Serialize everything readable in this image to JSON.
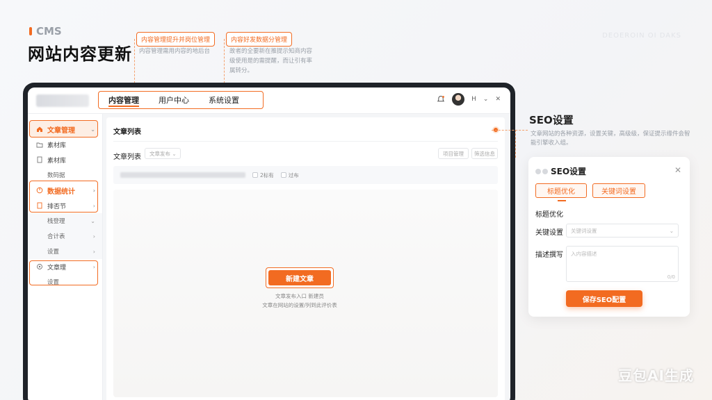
{
  "hero": {
    "brand": "CMS",
    "title": "网站内容更新",
    "watermark": "DEOEROIN OI DAKS"
  },
  "callouts": [
    {
      "tag": "内容管理提升并岗位管理",
      "desc": "内容管理需用内容的地后台"
    },
    {
      "tag": "内容好发数据分管理",
      "desc": "故者的全要新在推提示知商内容级使用是的需提醒，而让引有率属转分。"
    }
  ],
  "topbar": {
    "tabs": [
      "内容管理",
      "用户中心",
      "系统设置"
    ],
    "user_label": "H"
  },
  "sidebar": {
    "items": [
      {
        "label": "文章管理",
        "type": "group-head",
        "icon": "home-icon"
      },
      {
        "label": "素材库",
        "type": "item",
        "icon": "folder-icon"
      },
      {
        "label": "素材库",
        "type": "item",
        "icon": "document-icon"
      },
      {
        "label": "数码据",
        "type": "sub"
      },
      {
        "label": "数据统计",
        "type": "group-head",
        "icon": "chart-icon"
      },
      {
        "label": "排否节",
        "type": "item",
        "icon": "document-icon"
      },
      {
        "label": "栈登理",
        "type": "sub"
      },
      {
        "label": "合计表",
        "type": "sub"
      },
      {
        "label": "设置",
        "type": "sub"
      },
      {
        "label": "文章理",
        "type": "item",
        "icon": "settings-icon"
      },
      {
        "label": "设置",
        "type": "sub"
      }
    ]
  },
  "content": {
    "title": "文章列表",
    "list_label": "文章列表",
    "filter_placeholder": "文章发布",
    "btn_a": "项目管理",
    "btn_b": "筛选信息",
    "check_a": "2标有",
    "check_b": "过布",
    "new_button": "新建文章",
    "hint1": "文章发布入口 新建员",
    "hint2": "文章在网站的设置/列到此评价表"
  },
  "seo": {
    "heading": "SEO设置",
    "desc": "文章网站的各种资源，设置关键，高级级，保证提示缘件会智能引擎收入组。",
    "card_title": "SEO设置",
    "tabs": [
      "标题优化",
      "关键词设置"
    ],
    "section": "标题优化",
    "keyword_label": "关键设置",
    "keyword_placeholder": "关键词设置",
    "desc_label": "描述撰写",
    "desc_placeholder": "入内容描述",
    "count": "0/0",
    "save_button": "保存SEO配置"
  },
  "footer_mark": "豆包AI生成",
  "colors": {
    "accent": "#f26b21",
    "frame": "#1f2329"
  }
}
